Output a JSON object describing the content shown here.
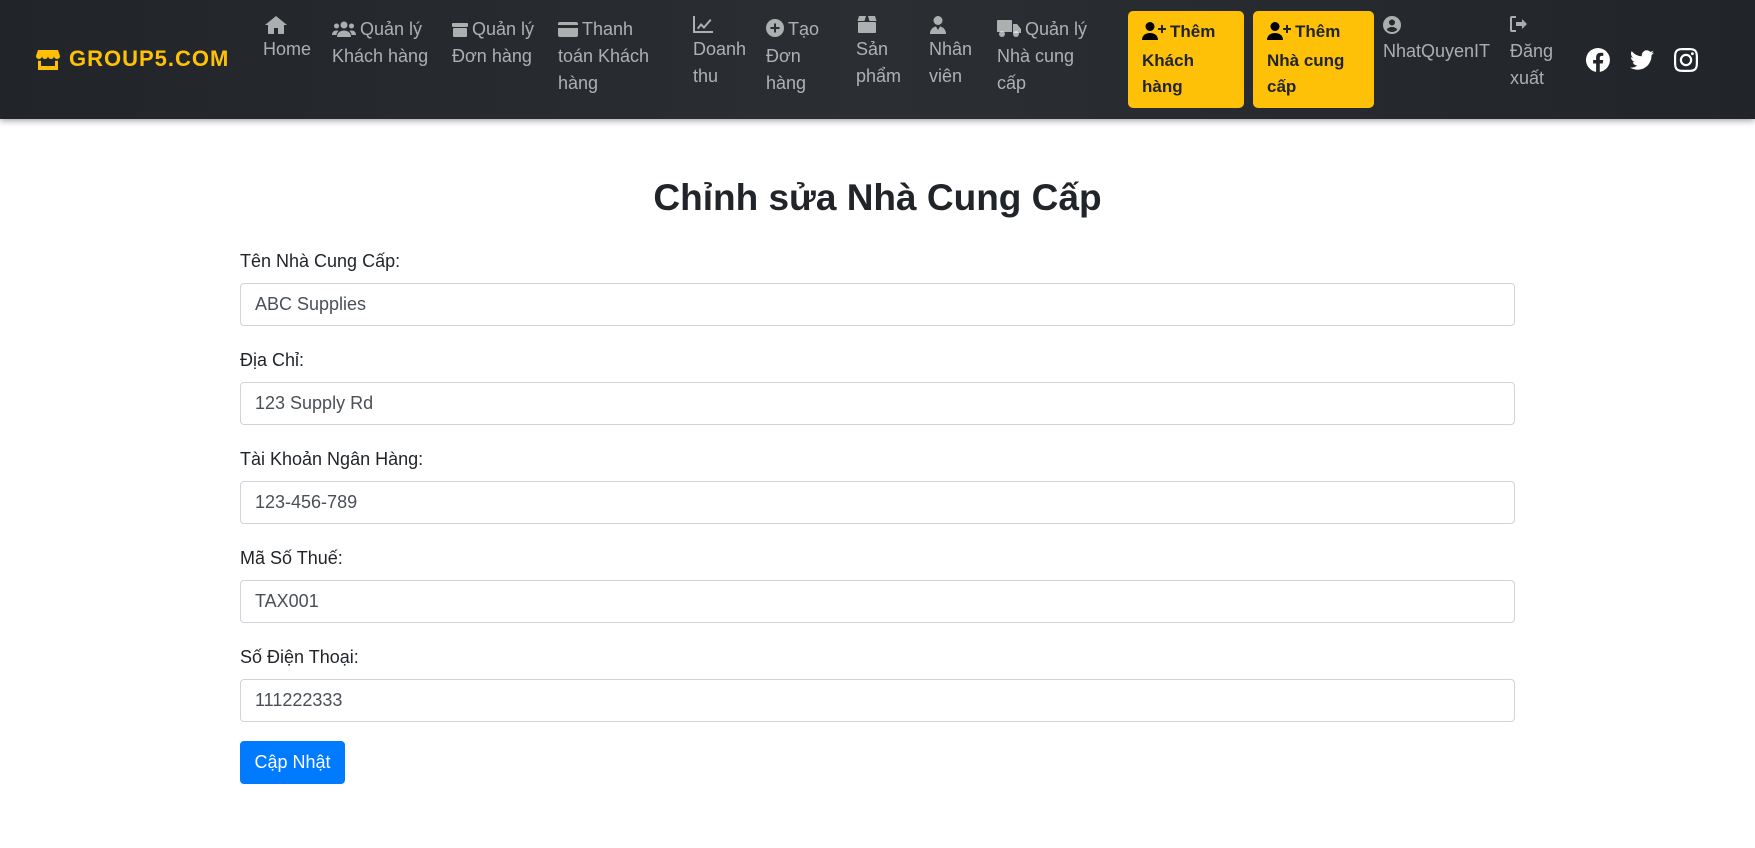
{
  "brand": {
    "name": "GROUP5.COM"
  },
  "nav": {
    "home": [
      "Home"
    ],
    "customers": [
      "Quản lý",
      "Khách hàng"
    ],
    "orders": [
      "Quản lý",
      "Đơn hàng"
    ],
    "payments": [
      "Thanh",
      "toán Khách",
      "hàng"
    ],
    "revenue": [
      "Doanh",
      "thu"
    ],
    "create_order": [
      "Tạo",
      "Đơn",
      "hàng"
    ],
    "products": [
      "Sản",
      "phẩm"
    ],
    "staff": [
      "Nhân",
      "viên"
    ],
    "suppliers": [
      "Quản lý",
      "Nhà cung",
      "cấp"
    ],
    "add_customer": [
      "Thêm",
      "Khách",
      "hàng"
    ],
    "add_supplier": [
      "Thêm",
      "Nhà cung",
      "cấp"
    ],
    "user": [
      "NhatQuyenIT"
    ],
    "logout": [
      "Đăng",
      "xuất"
    ]
  },
  "social": [
    "facebook-icon",
    "twitter-icon",
    "instagram-icon"
  ],
  "colors": {
    "navbar": "#212529",
    "accent": "#ffc107",
    "primary": "#007bff"
  },
  "form": {
    "title": "Chỉnh sửa Nhà Cung Cấp",
    "fields": [
      {
        "label": "Tên Nhà Cung Cấp:",
        "value": "ABC Supplies"
      },
      {
        "label": "Địa Chỉ:",
        "value": "123 Supply Rd"
      },
      {
        "label": "Tài Khoản Ngân Hàng:",
        "value": "123-456-789"
      },
      {
        "label": "Mã Số Thuế:",
        "value": "TAX001"
      },
      {
        "label": "Số Điện Thoại:",
        "value": "111222333"
      }
    ],
    "submit_label": "Cập Nhật"
  }
}
